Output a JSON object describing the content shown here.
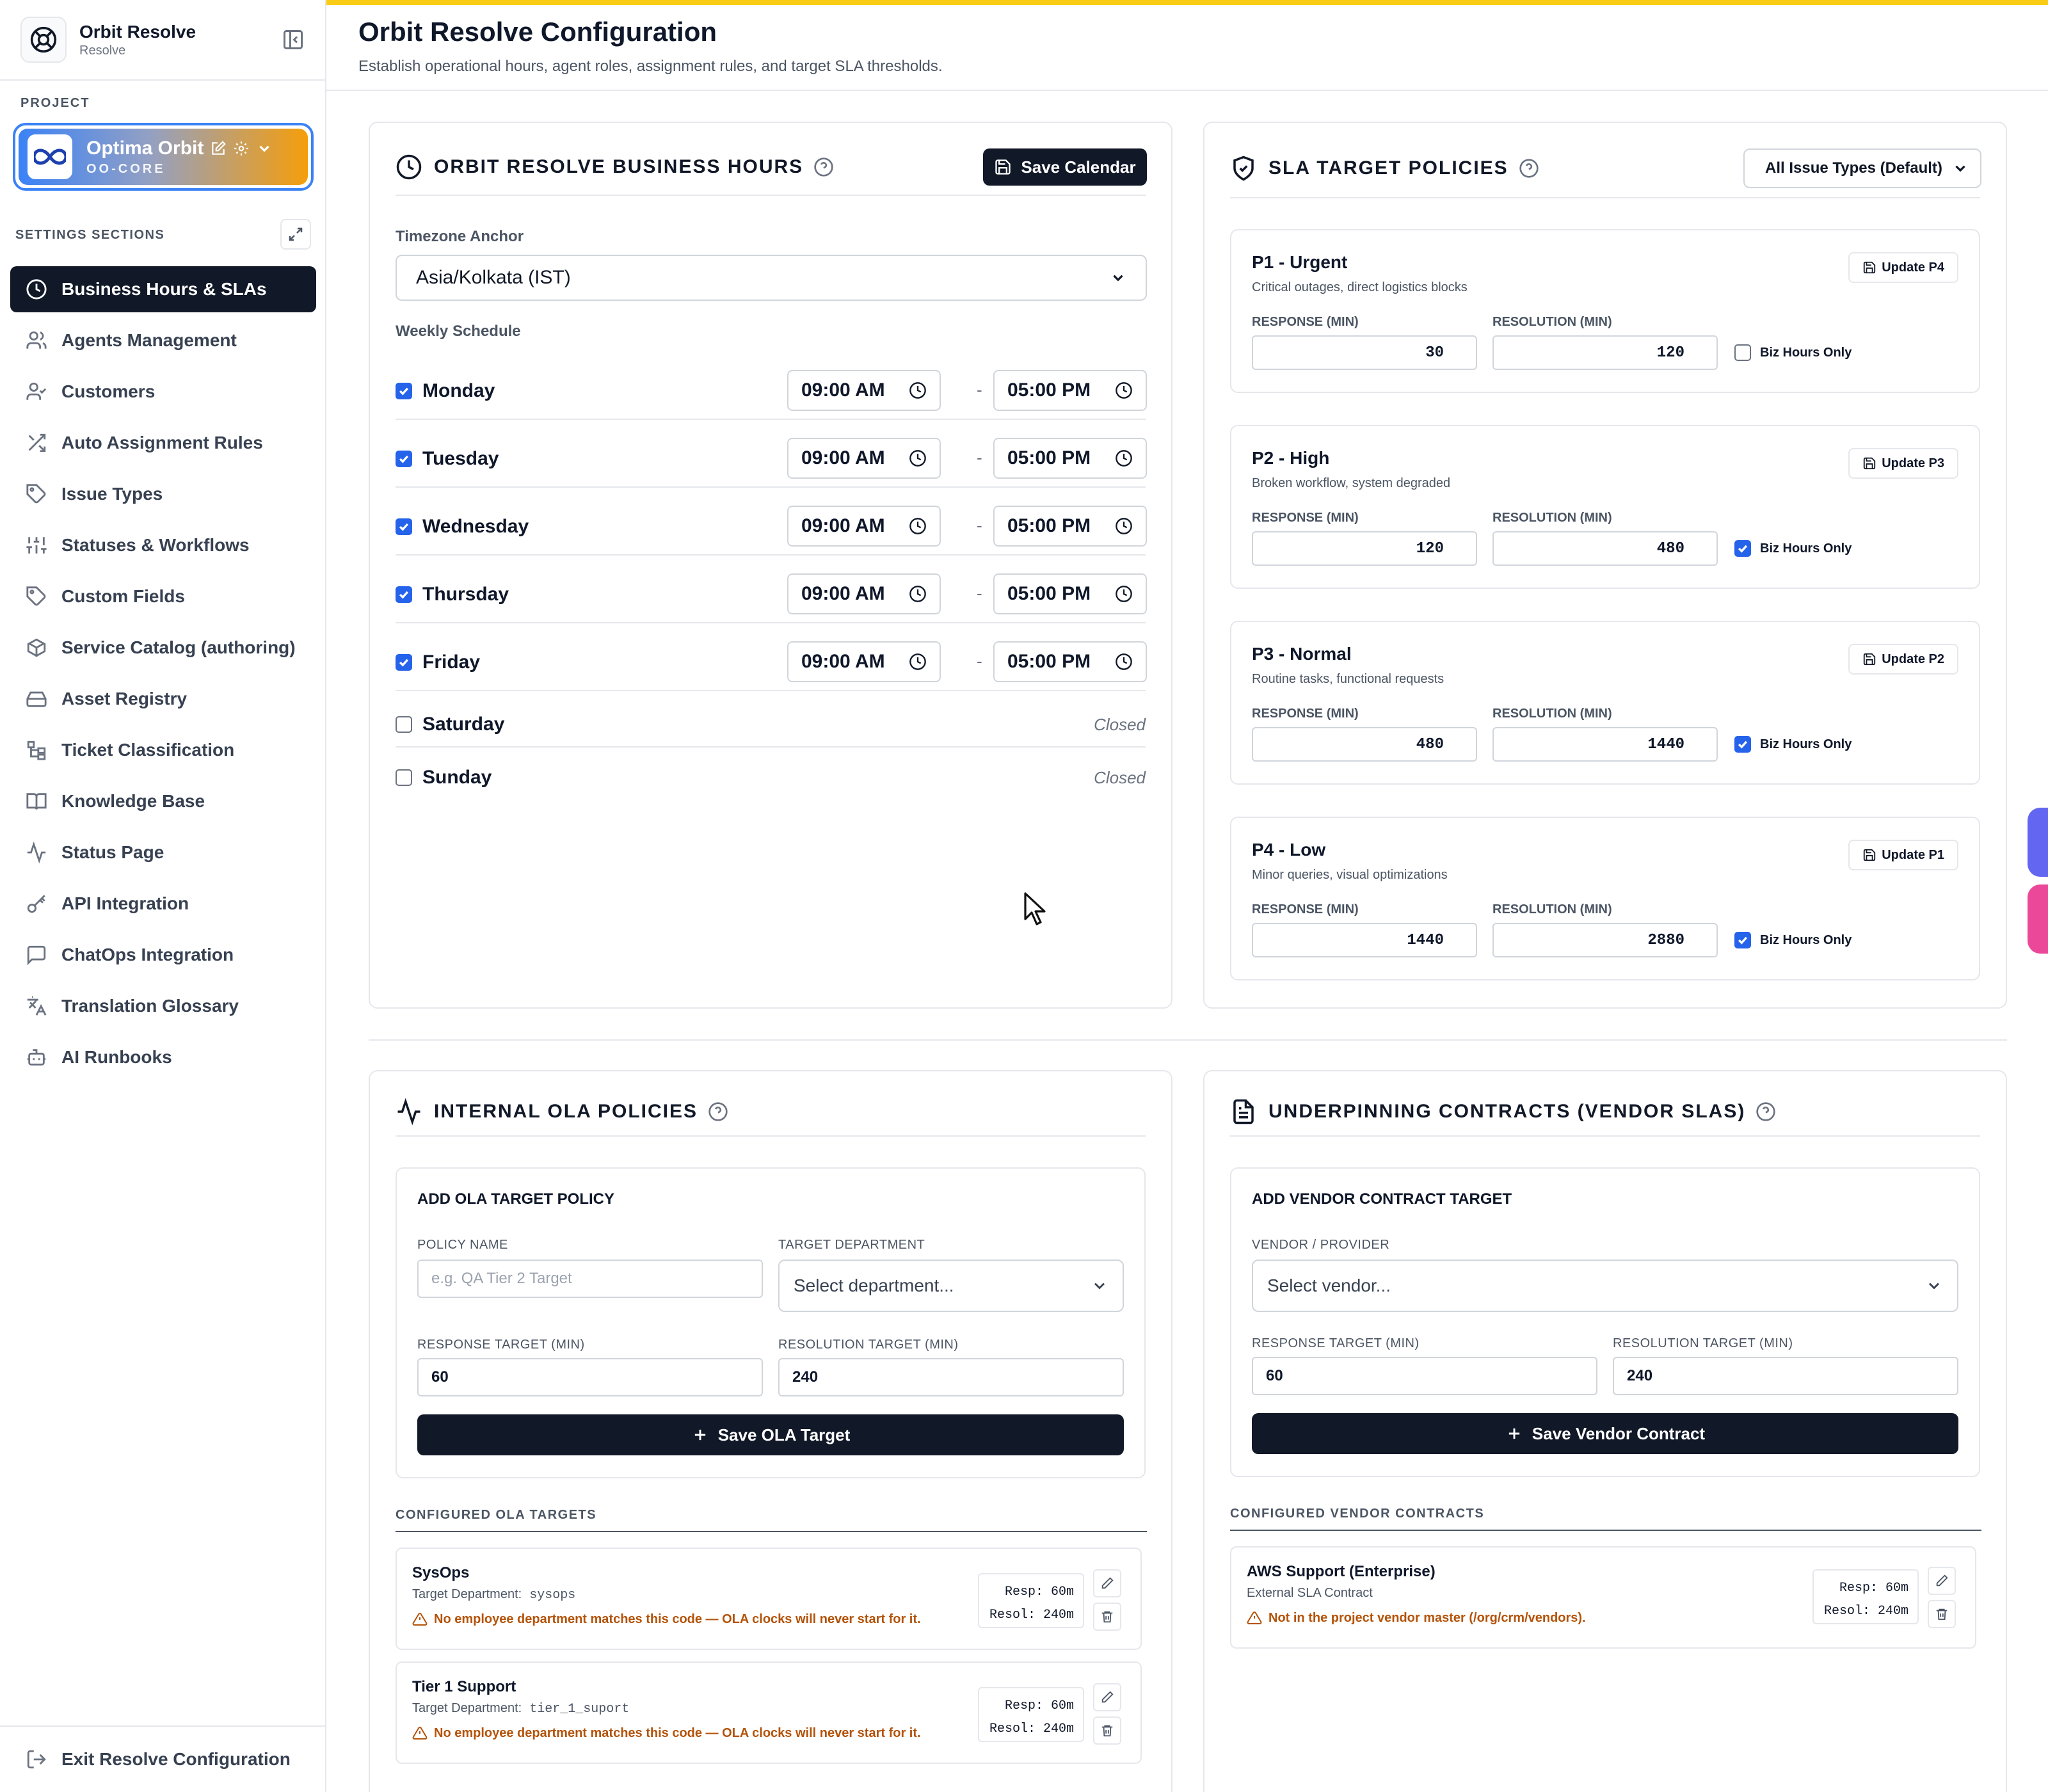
{
  "app": {
    "name": "Orbit Resolve",
    "subtitle": "Resolve"
  },
  "project": {
    "section_label": "PROJECT",
    "name": "Optima Orbit",
    "code": "OO-CORE"
  },
  "sidebar": {
    "section_label": "SETTINGS SECTIONS",
    "items": [
      {
        "label": "Business Hours & SLAs",
        "icon": "clock-icon",
        "active": true
      },
      {
        "label": "Agents Management",
        "icon": "users-icon"
      },
      {
        "label": "Customers",
        "icon": "user-check-icon"
      },
      {
        "label": "Auto Assignment Rules",
        "icon": "shuffle-icon"
      },
      {
        "label": "Issue Types",
        "icon": "tag-icon"
      },
      {
        "label": "Statuses & Workflows",
        "icon": "sliders-icon"
      },
      {
        "label": "Custom Fields",
        "icon": "tag-icon"
      },
      {
        "label": "Service Catalog (authoring)",
        "icon": "package-icon"
      },
      {
        "label": "Asset Registry",
        "icon": "hard-drive-icon"
      },
      {
        "label": "Ticket Classification",
        "icon": "hierarchy-icon"
      },
      {
        "label": "Knowledge Base",
        "icon": "book-icon"
      },
      {
        "label": "Status Page",
        "icon": "activity-icon"
      },
      {
        "label": "API Integration",
        "icon": "key-icon"
      },
      {
        "label": "ChatOps Integration",
        "icon": "message-icon"
      },
      {
        "label": "Translation Glossary",
        "icon": "languages-icon"
      },
      {
        "label": "AI Runbooks",
        "icon": "bot-icon"
      }
    ],
    "footer_label": "Exit Resolve Configuration"
  },
  "page": {
    "title": "Orbit Resolve Configuration",
    "subtitle": "Establish operational hours, agent roles, assignment rules, and target SLA thresholds."
  },
  "business_hours": {
    "title": "ORBIT RESOLVE BUSINESS HOURS",
    "save_label": "Save Calendar",
    "timezone_label": "Timezone Anchor",
    "timezone_value": "Asia/Kolkata (IST)",
    "schedule_label": "Weekly Schedule",
    "closed_label": "Closed",
    "days": [
      {
        "name": "Monday",
        "enabled": true,
        "start": "09:00 AM",
        "end": "05:00 PM"
      },
      {
        "name": "Tuesday",
        "enabled": true,
        "start": "09:00 AM",
        "end": "05:00 PM"
      },
      {
        "name": "Wednesday",
        "enabled": true,
        "start": "09:00 AM",
        "end": "05:00 PM"
      },
      {
        "name": "Thursday",
        "enabled": true,
        "start": "09:00 AM",
        "end": "05:00 PM"
      },
      {
        "name": "Friday",
        "enabled": true,
        "start": "09:00 AM",
        "end": "05:00 PM"
      },
      {
        "name": "Saturday",
        "enabled": false
      },
      {
        "name": "Sunday",
        "enabled": false
      }
    ]
  },
  "sla": {
    "title": "SLA TARGET POLICIES",
    "filter_value": "All Issue Types (Default)",
    "response_label": "RESPONSE (MIN)",
    "resolution_label": "RESOLUTION (MIN)",
    "biz_label": "Biz Hours Only",
    "policies": [
      {
        "name": "P1 - Urgent",
        "desc": "Critical outages, direct logistics blocks",
        "update_label": "Update P4",
        "response": "30",
        "resolution": "120",
        "biz_hours": false
      },
      {
        "name": "P2 - High",
        "desc": "Broken workflow, system degraded",
        "update_label": "Update P3",
        "response": "120",
        "resolution": "480",
        "biz_hours": true
      },
      {
        "name": "P3 - Normal",
        "desc": "Routine tasks, functional requests",
        "update_label": "Update P2",
        "response": "480",
        "resolution": "1440",
        "biz_hours": true
      },
      {
        "name": "P4 - Low",
        "desc": "Minor queries, visual optimizations",
        "update_label": "Update P1",
        "response": "1440",
        "resolution": "2880",
        "biz_hours": true
      }
    ]
  },
  "ola": {
    "title": "INTERNAL OLA POLICIES",
    "form_title": "ADD OLA TARGET POLICY",
    "policy_name_label": "POLICY NAME",
    "policy_name_placeholder": "e.g. QA Tier 2 Target",
    "department_label": "TARGET DEPARTMENT",
    "department_placeholder": "Select department...",
    "response_label": "RESPONSE TARGET (MIN)",
    "response_value": "60",
    "resolution_label": "RESOLUTION TARGET (MIN)",
    "resolution_value": "240",
    "save_label": "Save OLA Target",
    "configured_label": "CONFIGURED OLA TARGETS",
    "items": [
      {
        "name": "SysOps",
        "dept_label": "Target Department:",
        "dept_code": "sysops",
        "warning": "No employee department matches this code — OLA clocks will never start for it.",
        "resp": "Resp: 60m",
        "resol": "Resol: 240m"
      },
      {
        "name": "Tier 1 Support",
        "dept_label": "Target Department:",
        "dept_code": "tier_1_suport",
        "warning": "No employee department matches this code — OLA clocks will never start for it.",
        "resp": "Resp: 60m",
        "resol": "Resol: 240m"
      }
    ]
  },
  "vendor": {
    "title": "UNDERPINNING CONTRACTS (VENDOR SLAS)",
    "form_title": "ADD VENDOR CONTRACT TARGET",
    "vendor_label": "VENDOR / PROVIDER",
    "vendor_placeholder": "Select vendor...",
    "response_label": "RESPONSE TARGET (MIN)",
    "response_value": "60",
    "resolution_label": "RESOLUTION TARGET (MIN)",
    "resolution_value": "240",
    "save_label": "Save Vendor Contract",
    "configured_label": "CONFIGURED VENDOR CONTRACTS",
    "items": [
      {
        "name": "AWS Support (Enterprise)",
        "sub": "External SLA Contract",
        "warning": "Not in the project vendor master (/org/crm/vendors).",
        "resp": "Resp: 60m",
        "resol": "Resol: 240m"
      }
    ]
  },
  "colors": {
    "accent": "#111827",
    "topbar": "#facc15",
    "checkbox": "#2563eb",
    "warning": "#b45309"
  }
}
